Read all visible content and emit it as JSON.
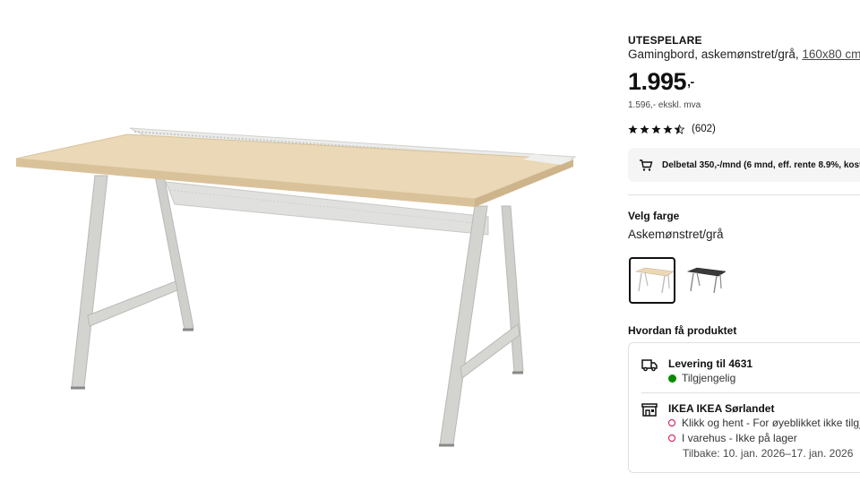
{
  "product": {
    "name": "UTESPELARE",
    "description": "Gamingbord, askemønstret/grå,",
    "size_link": "160x80 cm",
    "price": "1.995",
    "price_suffix": ",-",
    "price_ex_vat": "1.596,- ekskl. mva",
    "rating": 4.5,
    "review_count": "(602)",
    "image_icon": "gaming-desk-photo"
  },
  "finance": {
    "icon": "cart-icon",
    "text": "Delbetal 350,-/mnd (6 mnd, eff. rente 8.9%, kost"
  },
  "color": {
    "heading": "Velg farge",
    "selected_value": "Askemønstret/grå",
    "swatches": [
      {
        "name": "ash-grey",
        "selected": true
      },
      {
        "name": "black-grey",
        "selected": false
      }
    ]
  },
  "fulfillment": {
    "heading": "Hvordan få produktet",
    "delivery": {
      "icon": "truck-icon",
      "title": "Levering til 4631",
      "status": "Tilgjengelig",
      "status_color": "#0a8a00"
    },
    "store": {
      "icon": "store-icon",
      "title": "IKEA IKEA Sørlandet",
      "click_collect": "Klikk og hent - For øyeblikket ikke tilgje",
      "in_store": "I varehus - Ikke på lager",
      "back_in_stock": "Tilbake: 10. jan. 2026–17. jan. 2026",
      "status_color": "#cc0a5a"
    }
  },
  "colors": {
    "text": "#111111",
    "muted": "#484848",
    "panel": "#f5f5f5",
    "border": "#dfdfdf",
    "desk_top": "#e9d6b3",
    "frame": "#c9c9c5"
  }
}
